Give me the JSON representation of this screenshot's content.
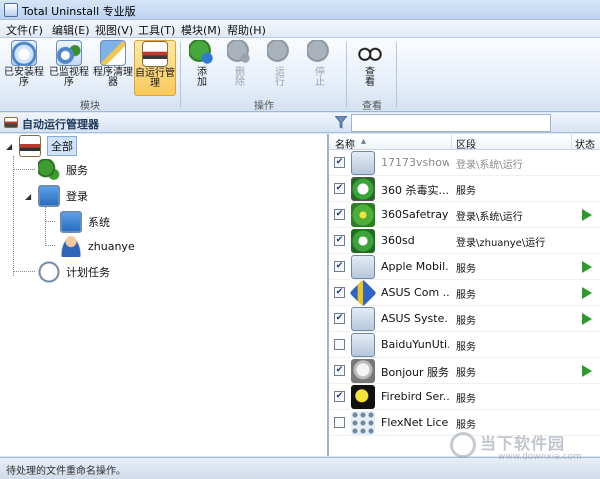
{
  "window": {
    "title": "Total Uninstall 专业版"
  },
  "menu": [
    "文件(F)",
    "编辑(E)",
    "视图(V)",
    "工具(T)",
    "模块(M)",
    "帮助(H)"
  ],
  "ribbon": {
    "groups": [
      {
        "label": "模块",
        "buttons": [
          "已安装程序",
          "已监视程序",
          "程序清理器",
          "自运行管理"
        ]
      },
      {
        "label": "操作",
        "buttons": [
          "添加",
          "删除",
          "运行",
          "停止"
        ]
      },
      {
        "label": "查看",
        "buttons": [
          "查看"
        ]
      }
    ],
    "button_rows": {
      "installed": [
        "已安装程",
        "序"
      ],
      "monitored": [
        "已监视程",
        "序"
      ],
      "cleaner": [
        "程序清理",
        "器"
      ],
      "autorun": [
        "自运行管",
        "理"
      ],
      "add": [
        "添",
        "加"
      ],
      "delete": [
        "删",
        "除"
      ],
      "run": [
        "运",
        "行"
      ],
      "stop": [
        "停",
        "止"
      ],
      "view": [
        "查",
        "看"
      ]
    }
  },
  "panel": {
    "title": "自动运行管理器",
    "filter_placeholder": ""
  },
  "tree": {
    "all": "全部",
    "services": "服务",
    "login": "登录",
    "system": "系统",
    "user": "zhuanye",
    "scheduled": "计划任务"
  },
  "list": {
    "columns": {
      "name": "名称",
      "section": "区段",
      "status": "状态"
    },
    "rows": [
      {
        "name": "17173vshow",
        "section": "登录\\系统\\运行",
        "checked": true,
        "dim": true,
        "running": false,
        "icon": "generic-app-icon"
      },
      {
        "name": "360 杀毒实...",
        "section": "服务",
        "checked": true,
        "dim": false,
        "running": false,
        "icon": "360-antivirus-icon"
      },
      {
        "name": "360Safetray",
        "section": "登录\\系统\\运行",
        "checked": true,
        "dim": false,
        "running": true,
        "icon": "360-safe-icon"
      },
      {
        "name": "360sd",
        "section": "登录\\zhuanye\\运行",
        "checked": true,
        "dim": false,
        "running": false,
        "icon": "360sd-icon"
      },
      {
        "name": "Apple Mobil...",
        "section": "服务",
        "checked": true,
        "dim": false,
        "running": true,
        "icon": "generic-app-icon"
      },
      {
        "name": "ASUS Com ...",
        "section": "服务",
        "checked": true,
        "dim": false,
        "running": true,
        "icon": "asus-icon"
      },
      {
        "name": "ASUS Syste...",
        "section": "服务",
        "checked": true,
        "dim": false,
        "running": true,
        "icon": "generic-app-icon"
      },
      {
        "name": "BaiduYunUti...",
        "section": "服务",
        "checked": false,
        "dim": false,
        "running": false,
        "icon": "generic-app-icon"
      },
      {
        "name": "Bonjour 服务",
        "section": "服务",
        "checked": true,
        "dim": false,
        "running": true,
        "icon": "bonjour-icon"
      },
      {
        "name": "Firebird Ser...",
        "section": "服务",
        "checked": true,
        "dim": false,
        "running": false,
        "icon": "firebird-icon"
      },
      {
        "name": "FlexNet Lice...",
        "section": "服务",
        "checked": false,
        "dim": false,
        "running": false,
        "icon": "flexnet-icon"
      }
    ]
  },
  "status": {
    "text": "待处理的文件重命名操作。"
  },
  "watermark": {
    "main": "当下软件园",
    "sub": "www.downxia.com"
  }
}
